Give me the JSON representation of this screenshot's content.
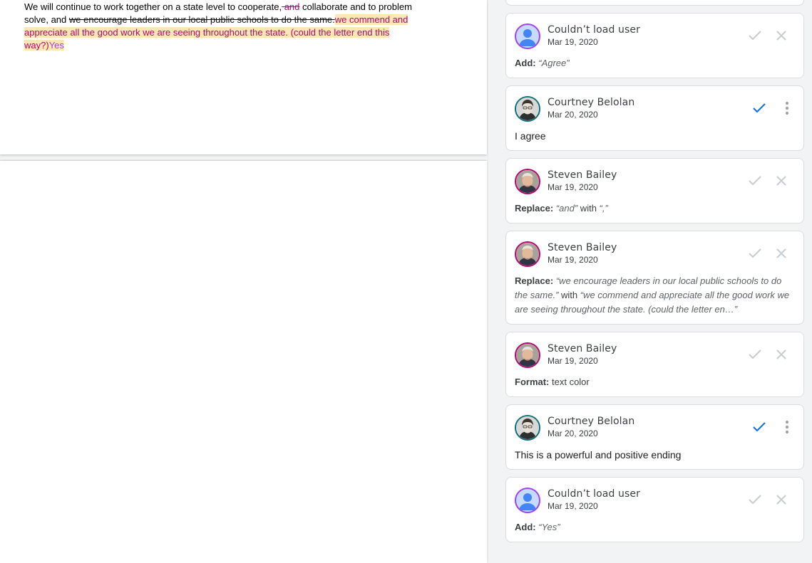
{
  "document": {
    "p1_a": "We will continue to work together on a state level to cooperate,",
    "p1_del_and": " and",
    "p1_b": " collaborate and to problem solve, and ",
    "p1_del_sentence": "we encourage leaders in our local public schools to do the same.",
    "p1_ins": "we commend and appreciate all the good work we are seeing throughout the state. (could the letter end this way?)",
    "p1_ins_yes": "Yes"
  },
  "comments": [
    {
      "author": "Couldn’t load user",
      "date": "Mar 19, 2020",
      "label": "Add:",
      "quote": "“Agree”",
      "avatar": "default-user-icon"
    },
    {
      "author": "Courtney Belolan",
      "date": "Mar 20, 2020",
      "text": "I agree",
      "avatar": "courtney-photo"
    },
    {
      "author": "Steven Bailey",
      "date": "Mar 19, 2020",
      "label": "Replace:",
      "quote": "“and”",
      "with": " with ",
      "quote2": "“,”",
      "avatar": "steven-photo"
    },
    {
      "author": "Steven Bailey",
      "date": "Mar 19, 2020",
      "label": "Replace:",
      "quote": "“we encourage leaders in our local public schools to do the same.”",
      "with": " with ",
      "quote2": "“we commend and appreciate all the good work we are seeing throughout the state. (could the letter en…”",
      "avatar": "steven-photo"
    },
    {
      "author": "Steven Bailey",
      "date": "Mar 19, 2020",
      "label": "Format:",
      "value": " text color",
      "avatar": "steven-photo"
    },
    {
      "author": "Courtney Belolan",
      "date": "Mar 20, 2020",
      "text": "This is a powerful and positive ending",
      "avatar": "courtney-photo"
    },
    {
      "author": "Couldn’t load user",
      "date": "Mar 19, 2020",
      "label": "Add:",
      "quote": "“Yes”",
      "avatar": "default-user-icon"
    }
  ],
  "colors": {
    "accept_blue": "#1a73e8",
    "muted_icon": "#c8ccd0",
    "suggest_pink": "#b80672",
    "highlight": "#fde7b5"
  }
}
